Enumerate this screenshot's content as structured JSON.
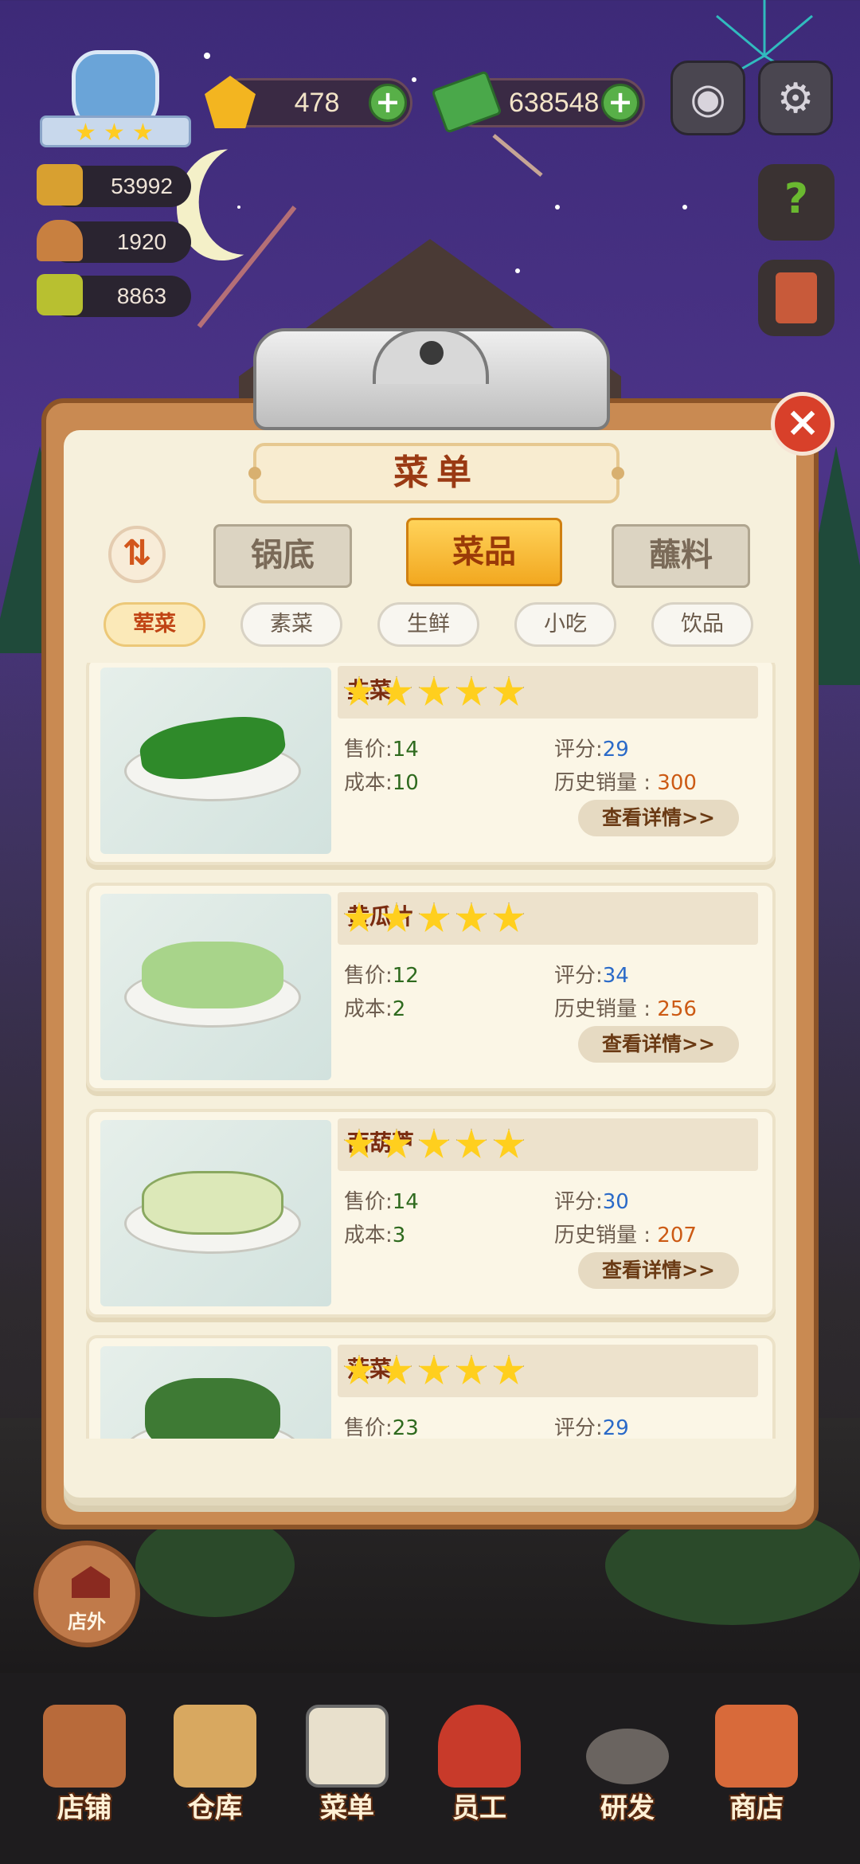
{
  "hud": {
    "rank_stars": 3,
    "gems": "478",
    "cash": "638548",
    "stats": [
      "53992",
      "1920",
      "8863"
    ]
  },
  "menu": {
    "title": "菜单",
    "main_tabs": [
      {
        "label": "锅底",
        "active": false
      },
      {
        "label": "菜品",
        "active": true
      },
      {
        "label": "蘸料",
        "active": false
      }
    ],
    "sub_tabs": [
      {
        "label": "荤菜",
        "active": true
      },
      {
        "label": "素菜",
        "active": false
      },
      {
        "label": "生鲜",
        "active": false
      },
      {
        "label": "小吃",
        "active": false
      },
      {
        "label": "饮品",
        "active": false
      }
    ],
    "field_labels": {
      "price": "售价:",
      "cost": "成本:",
      "rating": "评分:",
      "sales": "历史销量 : ",
      "detail": "查看详情>>"
    },
    "dishes": [
      {
        "name": "韭菜",
        "stars": 5,
        "price": "14",
        "cost": "10",
        "rating": "29",
        "sales": "300",
        "color": "#2f8a2a"
      },
      {
        "name": "黄瓜片",
        "stars": 5,
        "price": "12",
        "cost": "2",
        "rating": "34",
        "sales": "256",
        "color": "#a8d48a"
      },
      {
        "name": "西葫芦",
        "stars": 5,
        "price": "14",
        "cost": "3",
        "rating": "30",
        "sales": "207",
        "color": "#dce8b8"
      },
      {
        "name": "菠菜",
        "stars": 5,
        "price": "23",
        "cost": "",
        "rating": "29",
        "sales": "",
        "color": "#3e7a34"
      }
    ]
  },
  "outside_button": {
    "label": "店外"
  },
  "nav": [
    {
      "label": "店铺",
      "icon": "shop-building-icon"
    },
    {
      "label": "仓库",
      "icon": "warehouse-boxes-icon"
    },
    {
      "label": "菜单",
      "icon": "menu-clipboard-icon"
    },
    {
      "label": "员工",
      "icon": "staff-person-icon"
    },
    {
      "label": "研发",
      "icon": "research-wok-icon"
    },
    {
      "label": "商店",
      "icon": "store-stall-icon"
    }
  ],
  "colors": {
    "accent_orange": "#f2a820",
    "close_red": "#d8402a",
    "plus_green": "#58b048"
  }
}
